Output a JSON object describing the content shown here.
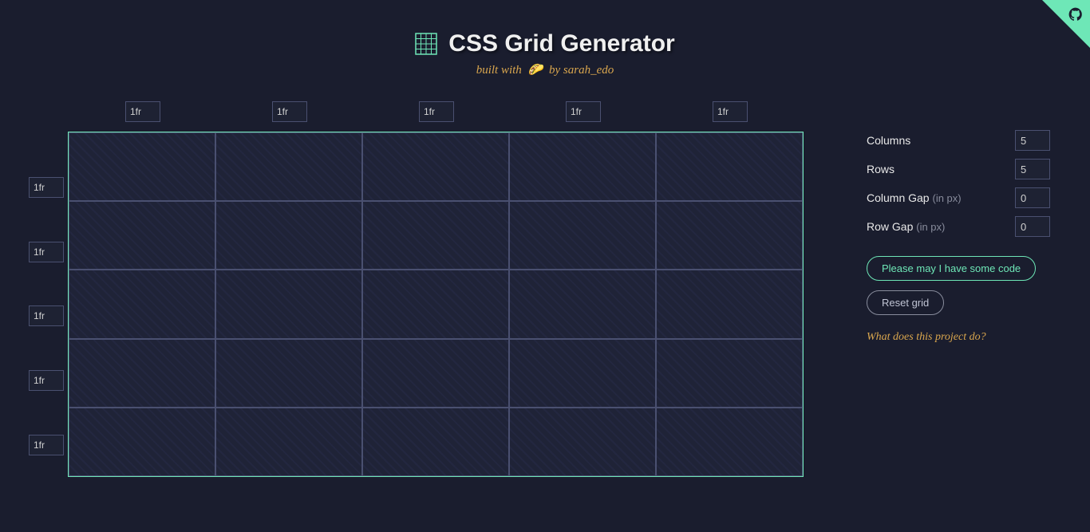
{
  "header": {
    "title": "CSS Grid Generator",
    "subtitle_prefix": "built with",
    "subtitle_emoji": "🌮",
    "subtitle_by": "by",
    "subtitle_author": "sarah_edo"
  },
  "grid": {
    "col_units": [
      "1fr",
      "1fr",
      "1fr",
      "1fr",
      "1fr"
    ],
    "row_units": [
      "1fr",
      "1fr",
      "1fr",
      "1fr",
      "1fr"
    ]
  },
  "controls": {
    "columns_label": "Columns",
    "columns_value": "5",
    "rows_label": "Rows",
    "rows_value": "5",
    "colgap_label": "Column Gap",
    "colgap_hint": "(in px)",
    "colgap_value": "0",
    "rowgap_label": "Row Gap",
    "rowgap_hint": "(in px)",
    "rowgap_value": "0",
    "generate_btn": "Please may I have some code",
    "reset_btn": "Reset grid",
    "project_link": "What does this project do?"
  },
  "colors": {
    "accent": "#6ee7b7",
    "background": "#1a1d2e",
    "subtitle": "#d9a64e"
  }
}
